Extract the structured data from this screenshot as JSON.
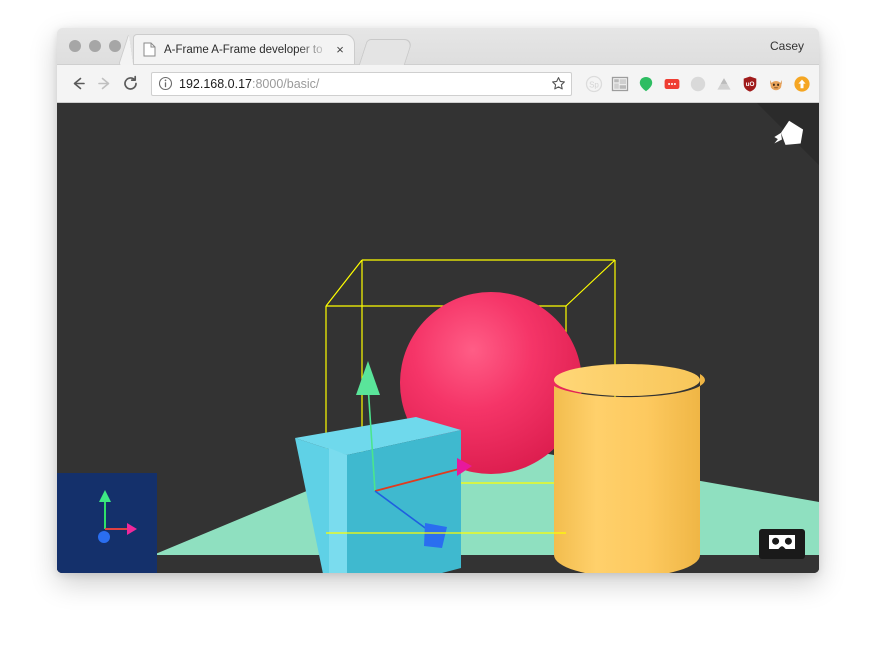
{
  "window": {
    "traffic_lights": [
      "close",
      "minimize",
      "maximize"
    ],
    "profile_name": "Casey"
  },
  "tab": {
    "title": "A-Frame A-Frame developer to",
    "favicon": "document-icon",
    "close_label": "×",
    "new_tab_label": ""
  },
  "toolbar": {
    "back_label": "←",
    "forward_label": "→",
    "reload_label": "⟳",
    "info_icon": "info-circle-icon",
    "url_host": "192.168.0.17",
    "url_path": ":8000/basic/",
    "url_full": "192.168.0.17:8000/basic/",
    "star_label": "☆",
    "extensions": [
      {
        "name": "sp-extension-icon",
        "color": "#cfcfcf"
      },
      {
        "name": "grid-layout-extension-icon",
        "color": "#9a9a9a"
      },
      {
        "name": "green-balloon-extension-icon",
        "color": "#2ebd62"
      },
      {
        "name": "red-chat-extension-icon",
        "color": "#ef3e33"
      },
      {
        "name": "grey-moon-extension-icon",
        "color": "#bdbdbd"
      },
      {
        "name": "drive-extension-icon",
        "color": "#bdbdbd"
      },
      {
        "name": "ublock-shield-extension-icon",
        "color": "#a01b1b"
      },
      {
        "name": "cat-extension-icon",
        "color": "#e8a35a"
      },
      {
        "name": "orange-upload-extension-icon",
        "color": "#f5a623"
      }
    ]
  },
  "viewport": {
    "background_color": "#333333",
    "logo_icon": "a-frame-logo-icon",
    "vr_button_icon": "vr-goggles-icon",
    "axis_widget": {
      "background_color": "#14306b",
      "axes": [
        {
          "name": "y-axis",
          "color": "#2ee06a",
          "direction": "up"
        },
        {
          "name": "x-axis",
          "color": "#e8275c",
          "direction": "right"
        },
        {
          "name": "z-axis",
          "color": "#1f6fe0",
          "direction": "toward-viewer"
        }
      ]
    },
    "scene_objects": [
      {
        "name": "ground-plane",
        "shape": "plane",
        "color": "#8fe0c0"
      },
      {
        "name": "sphere-primitive",
        "shape": "sphere",
        "color": "#ef2d5e"
      },
      {
        "name": "cube-primitive",
        "shape": "box",
        "color": "#4cc3d9"
      },
      {
        "name": "cylinder-primitive",
        "shape": "cylinder",
        "color": "#ffc65d"
      },
      {
        "name": "selection-wireframe",
        "shape": "box-helper",
        "color": "#ffff00"
      }
    ],
    "transform_gizmo": {
      "x_axis_color": "#e8275c",
      "y_axis_color": "#2ee06a",
      "z_axis_color": "#1f6fe0"
    }
  }
}
